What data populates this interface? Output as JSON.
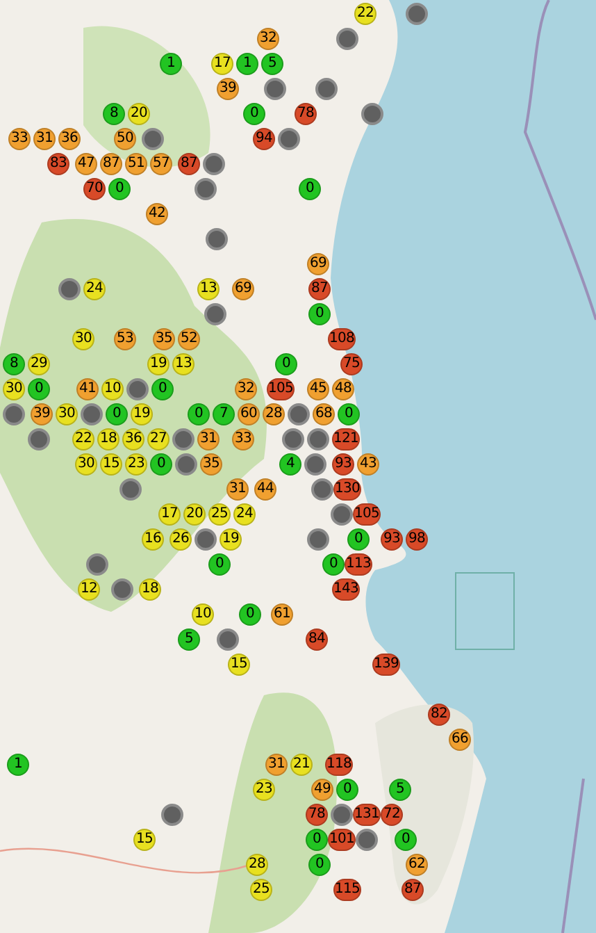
{
  "map": {
    "markers": [
      {
        "value": "22",
        "color": "#e8e020"
      },
      {
        "color": "#606060"
      },
      {
        "value": "32",
        "color": "#f0a030"
      },
      {
        "color": "#606060"
      },
      {
        "value": "1",
        "color": "#22c422"
      },
      {
        "value": "17",
        "color": "#e8e020"
      },
      {
        "value": "1",
        "color": "#22c422"
      },
      {
        "value": "5",
        "color": "#22c422"
      },
      {
        "value": "39",
        "color": "#f0a030"
      },
      {
        "color": "#606060"
      },
      {
        "color": "#606060"
      },
      {
        "value": "8",
        "color": "#22c422"
      },
      {
        "value": "20",
        "color": "#e8e020"
      },
      {
        "value": "0",
        "color": "#22c422"
      },
      {
        "value": "78",
        "color": "#d84a28"
      },
      {
        "color": "#606060"
      },
      {
        "value": "33",
        "color": "#f0a030"
      },
      {
        "value": "31",
        "color": "#f0a030"
      },
      {
        "value": "36",
        "color": "#f0a030"
      },
      {
        "value": "50",
        "color": "#f0a030"
      },
      {
        "color": "#606060"
      },
      {
        "value": "94",
        "color": "#d84a28"
      },
      {
        "color": "#606060"
      },
      {
        "value": "83",
        "color": "#d84a28"
      },
      {
        "value": "47",
        "color": "#f0a030"
      },
      {
        "value": "87",
        "color": "#f0a030"
      },
      {
        "value": "51",
        "color": "#f0a030"
      },
      {
        "value": "57",
        "color": "#f0a030"
      },
      {
        "value": "87",
        "color": "#d84a28"
      },
      {
        "color": "#606060"
      },
      {
        "value": "70",
        "color": "#d84a28"
      },
      {
        "value": "0",
        "color": "#22c422"
      },
      {
        "color": "#606060"
      },
      {
        "value": "0",
        "color": "#22c422"
      },
      {
        "value": "42",
        "color": "#f0a030"
      },
      {
        "color": "#606060"
      },
      {
        "value": "69",
        "color": "#f0a030"
      },
      {
        "color": "#606060"
      },
      {
        "value": "24",
        "color": "#e8e020"
      },
      {
        "value": "13",
        "color": "#e8e020"
      },
      {
        "value": "69",
        "color": "#f0a030"
      },
      {
        "value": "87",
        "color": "#d84a28"
      },
      {
        "color": "#606060"
      },
      {
        "value": "0",
        "color": "#22c422"
      },
      {
        "value": "30",
        "color": "#e8e020"
      },
      {
        "value": "53",
        "color": "#f0a030"
      },
      {
        "value": "35",
        "color": "#f0a030"
      },
      {
        "value": "52",
        "color": "#f0a030"
      },
      {
        "value": "108",
        "color": "#d84a28"
      },
      {
        "value": "8",
        "color": "#22c422"
      },
      {
        "value": "29",
        "color": "#e8e020"
      },
      {
        "value": "19",
        "color": "#e8e020"
      },
      {
        "value": "13",
        "color": "#e8e020"
      },
      {
        "value": "0",
        "color": "#22c422"
      },
      {
        "value": "75",
        "color": "#d84a28"
      },
      {
        "value": "30",
        "color": "#e8e020"
      },
      {
        "value": "0",
        "color": "#22c422"
      },
      {
        "value": "41",
        "color": "#f0a030"
      },
      {
        "value": "10",
        "color": "#e8e020"
      },
      {
        "color": "#606060"
      },
      {
        "value": "0",
        "color": "#22c422"
      },
      {
        "value": "32",
        "color": "#f0a030"
      },
      {
        "value": "105",
        "color": "#d84a28"
      },
      {
        "value": "45",
        "color": "#f0a030"
      },
      {
        "value": "48",
        "color": "#f0a030"
      },
      {
        "color": "#606060"
      },
      {
        "value": "39",
        "color": "#f0a030"
      },
      {
        "value": "30",
        "color": "#e8e020"
      },
      {
        "color": "#606060"
      },
      {
        "value": "0",
        "color": "#22c422"
      },
      {
        "value": "19",
        "color": "#e8e020"
      },
      {
        "value": "0",
        "color": "#22c422"
      },
      {
        "value": "7",
        "color": "#22c422"
      },
      {
        "value": "60",
        "color": "#f0a030"
      },
      {
        "value": "28",
        "color": "#f0a030"
      },
      {
        "color": "#606060"
      },
      {
        "value": "68",
        "color": "#f0a030"
      },
      {
        "value": "0",
        "color": "#22c422"
      },
      {
        "color": "#606060"
      },
      {
        "value": "22",
        "color": "#e8e020"
      },
      {
        "value": "18",
        "color": "#e8e020"
      },
      {
        "value": "36",
        "color": "#e8e020"
      },
      {
        "value": "27",
        "color": "#e8e020"
      },
      {
        "color": "#606060"
      },
      {
        "value": "31",
        "color": "#f0a030"
      },
      {
        "value": "33",
        "color": "#f0a030"
      },
      {
        "color": "#606060"
      },
      {
        "color": "#606060"
      },
      {
        "value": "121",
        "color": "#d84a28"
      },
      {
        "value": "30",
        "color": "#e8e020"
      },
      {
        "value": "15",
        "color": "#e8e020"
      },
      {
        "value": "23",
        "color": "#e8e020"
      },
      {
        "value": "0",
        "color": "#22c422"
      },
      {
        "color": "#606060"
      },
      {
        "value": "35",
        "color": "#f0a030"
      },
      {
        "value": "4",
        "color": "#22c422"
      },
      {
        "color": "#606060"
      },
      {
        "value": "93",
        "color": "#d84a28"
      },
      {
        "value": "43",
        "color": "#f0a030"
      },
      {
        "color": "#606060"
      },
      {
        "value": "31",
        "color": "#f0a030"
      },
      {
        "value": "44",
        "color": "#f0a030"
      },
      {
        "color": "#606060"
      },
      {
        "value": "130",
        "color": "#d84a28"
      },
      {
        "value": "17",
        "color": "#e8e020"
      },
      {
        "value": "20",
        "color": "#e8e020"
      },
      {
        "value": "25",
        "color": "#e8e020"
      },
      {
        "value": "24",
        "color": "#e8e020"
      },
      {
        "color": "#606060"
      },
      {
        "value": "105",
        "color": "#d84a28"
      },
      {
        "value": "16",
        "color": "#e8e020"
      },
      {
        "value": "26",
        "color": "#e8e020"
      },
      {
        "color": "#606060"
      },
      {
        "value": "19",
        "color": "#e8e020"
      },
      {
        "color": "#606060"
      },
      {
        "value": "0",
        "color": "#22c422"
      },
      {
        "value": "93",
        "color": "#d84a28"
      },
      {
        "value": "98",
        "color": "#d84a28"
      },
      {
        "color": "#606060"
      },
      {
        "value": "0",
        "color": "#22c422"
      },
      {
        "value": "0",
        "color": "#22c422"
      },
      {
        "value": "113",
        "color": "#d84a28"
      },
      {
        "value": "12",
        "color": "#e8e020"
      },
      {
        "color": "#606060"
      },
      {
        "value": "18",
        "color": "#e8e020"
      },
      {
        "value": "143",
        "color": "#d84a28"
      },
      {
        "value": "10",
        "color": "#e8e020"
      },
      {
        "value": "0",
        "color": "#22c422"
      },
      {
        "value": "61",
        "color": "#f0a030"
      },
      {
        "value": "5",
        "color": "#22c422"
      },
      {
        "color": "#606060"
      },
      {
        "value": "84",
        "color": "#d84a28"
      },
      {
        "value": "15",
        "color": "#e8e020"
      },
      {
        "value": "139",
        "color": "#d84a28"
      },
      {
        "value": "82",
        "color": "#d84a28"
      },
      {
        "value": "66",
        "color": "#f0a030"
      },
      {
        "value": "1",
        "color": "#22c422"
      },
      {
        "value": "31",
        "color": "#f0a030"
      },
      {
        "value": "21",
        "color": "#e8e020"
      },
      {
        "value": "118",
        "color": "#d84a28"
      },
      {
        "value": "23",
        "color": "#e8e020"
      },
      {
        "value": "49",
        "color": "#f0a030"
      },
      {
        "value": "0",
        "color": "#22c422"
      },
      {
        "value": "5",
        "color": "#22c422"
      },
      {
        "color": "#606060"
      },
      {
        "value": "78",
        "color": "#d84a28"
      },
      {
        "color": "#606060"
      },
      {
        "value": "131",
        "color": "#d84a28"
      },
      {
        "value": "72",
        "color": "#d84a28"
      },
      {
        "value": "15",
        "color": "#e8e020"
      },
      {
        "value": "0",
        "color": "#22c422"
      },
      {
        "value": "101",
        "color": "#d84a28"
      },
      {
        "color": "#606060"
      },
      {
        "value": "0",
        "color": "#22c422"
      },
      {
        "value": "28",
        "color": "#e8e020"
      },
      {
        "value": "0",
        "color": "#22c422"
      },
      {
        "value": "62",
        "color": "#f0a030"
      },
      {
        "value": "25",
        "color": "#e8e020"
      },
      {
        "value": "115",
        "color": "#d84a28"
      },
      {
        "value": "87",
        "color": "#d84a28"
      }
    ]
  }
}
